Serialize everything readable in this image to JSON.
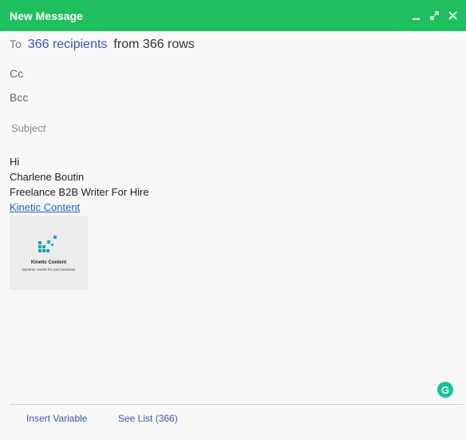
{
  "window": {
    "title": "New Message",
    "controls": [
      "minimize-icon",
      "expand-icon",
      "close-icon"
    ],
    "accent_color": "#1fbf5f"
  },
  "to": {
    "label": "To",
    "recipients_text": "366 recipients",
    "from_text": "from 366 rows"
  },
  "cc": {
    "label": "Cc"
  },
  "bcc": {
    "label": "Bcc"
  },
  "subject": {
    "placeholder": "Subject",
    "value": ""
  },
  "body": {
    "lines": [
      "Hi",
      "Charlene Boutin",
      "Freelance B2B Writer For Hire"
    ],
    "link_text": "Kinetic Content",
    "logo": {
      "name": "Kinetic Content",
      "tagline": "Dynamic words for your business",
      "color": "#1aa6b7"
    }
  },
  "footer": {
    "insert_variable": "Insert Variable",
    "see_list": "See List (366)"
  },
  "grammarly": {
    "label": "G",
    "color": "#15c39a"
  }
}
